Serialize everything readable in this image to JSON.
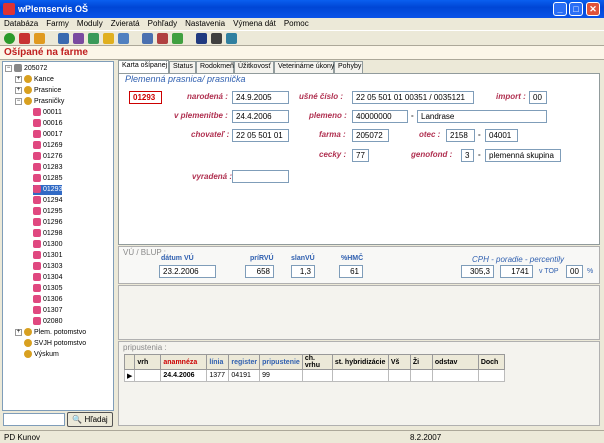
{
  "window": {
    "title": "wPlemservis OŠ",
    "min": "_",
    "max": "□",
    "close": "✕"
  },
  "menu": [
    "Databáza",
    "Farmy",
    "Moduly",
    "Zvieratá",
    "Pohľady",
    "Nastavenia",
    "Výmena dát",
    "Pomoc"
  ],
  "app_title": "Ošípané na farme",
  "tree": {
    "root": "205072",
    "groups": [
      "Kance",
      "Prasnice",
      "Prasničky"
    ],
    "items": [
      "00011",
      "00016",
      "00017",
      "01269",
      "01276",
      "01283",
      "01285",
      "01293",
      "01294",
      "01295",
      "01296",
      "01298",
      "01300",
      "01301",
      "01303",
      "01304",
      "01305",
      "01306",
      "01307",
      "02080"
    ],
    "bottom": [
      "Plem. potomstvo",
      "SVJH potomstvo",
      "Výskum"
    ]
  },
  "search": {
    "value": "",
    "button": "Hľadaj"
  },
  "tabs": [
    "Karta ošípanej",
    "Status",
    "Rodokmeň",
    "Úžitkovosť",
    "Veterinárne úkony",
    "Pohyby"
  ],
  "card": {
    "section": "Plemenná prasnica/ prasnička",
    "id": "01293",
    "narodena_label": "narodená :",
    "narodena": "24.9.2005",
    "usne_label": "ušné číslo :",
    "usne": "22 05 501 01  00351 / 0035121",
    "import_label": "import :",
    "import": "00",
    "plemenitbe_label": "v plemenitbe :",
    "plemenitbe": "24.4.2006",
    "plemeno_label": "plemeno :",
    "plemeno_code": "40000000",
    "plemeno_dash": "-",
    "plemeno_name": "Landrase",
    "chovatel_label": "chovateľ :",
    "chovatel": "22 05 501 01",
    "farma_label": "farma :",
    "farma": "205072",
    "otec_label": "otec :",
    "otec1": "2158",
    "otec_dash": "-",
    "otec2": "04001",
    "cecky_label": "cecky :",
    "cecky": "77",
    "genofond_label": "genofond :",
    "genofond": "3",
    "genofond_dash": "-",
    "genofond_name": "plemenná skupina",
    "vyradena_label": "vyradená :",
    "vyradena": ""
  },
  "vu": {
    "section": "VÚ / BLUP :",
    "datum_label": "dátum VÚ",
    "datum": "23.2.2006",
    "priru_label": "príRVÚ",
    "priru": "658",
    "slan_label": "slanVÚ",
    "slan": "1,3",
    "hmc_label": "%HMČ",
    "hmc": "61",
    "cph_label": "CPH - poradie - percentily",
    "cph": "305,3",
    "poradie": "1741",
    "vtop_label": "v TOP",
    "vtop": "00",
    "pct": "%"
  },
  "pripustenia": {
    "section": "pripustenia :",
    "columns": [
      "vrh",
      "anamnéza",
      "línia",
      "register",
      "pripustenie",
      "ch. vrhu",
      "st. hybridizácie",
      "Vš",
      "Ži",
      "odstav",
      "Doch"
    ],
    "row": {
      "marker": "▶",
      "vrh": "",
      "anamneza": "24.4.2006",
      "linia": "1377",
      "register": "04191",
      "pripustenie": "99"
    }
  },
  "status": {
    "user": "PD Kunov",
    "date": "8.2.2007"
  }
}
